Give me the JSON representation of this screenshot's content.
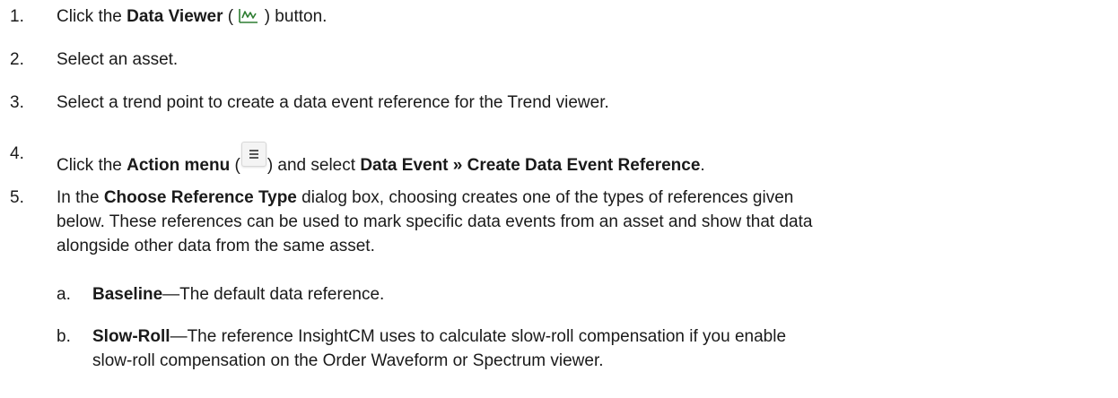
{
  "steps": [
    {
      "number": "1.",
      "before": "Click the ",
      "bold": "Data Viewer",
      "middle": " ( ",
      "after": " ) button."
    },
    {
      "number": "2.",
      "text": "Select an asset."
    },
    {
      "number": "3.",
      "text": "Select a trend point to create a data event reference for the Trend viewer."
    },
    {
      "number": "4.",
      "before": "Click the ",
      "bold1": "Action menu",
      "middle": " (",
      "after_icon": ") and select ",
      "bold2": "Data Event » Create Data Event Reference",
      "end": "."
    },
    {
      "number": "5.",
      "before": "In the ",
      "bold": "Choose Reference Type",
      "line1_rest": " dialog box, choosing creates one of the types of references given",
      "line2": "below. These references can be used to mark specific data events from an asset and show that data",
      "line3": "alongside other data from the same asset."
    }
  ],
  "substeps": [
    {
      "letter": "a.",
      "bold": "Baseline",
      "rest": "—The default data reference."
    },
    {
      "letter": "b.",
      "bold": "Slow-Roll",
      "rest": "—The reference InsightCM uses to calculate slow-roll compensation if you enable",
      "line2": "slow-roll compensation on the Order Waveform or Spectrum viewer."
    }
  ],
  "icons": {
    "data_viewer": "trend-chart-icon",
    "action_menu": "hamburger-menu-icon",
    "data_viewer_color": "#2e7d32"
  }
}
